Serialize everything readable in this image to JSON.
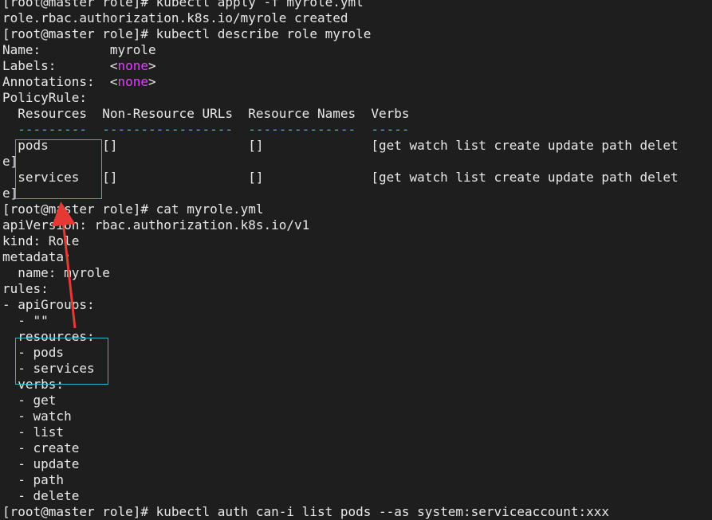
{
  "terminal": {
    "lines": [
      {
        "t": "[root@master role]# kubectl apply -f myrole.yml"
      },
      {
        "t": "role.rbac.authorization.k8s.io/myrole created"
      },
      {
        "t": "[root@master role]# kubectl describe role myrole"
      },
      {
        "t": "Name:         myrole"
      },
      {
        "t": "Labels:       <",
        "none": "none",
        "after": ">"
      },
      {
        "t": "Annotations:  <",
        "none": "none",
        "after": ">"
      },
      {
        "t": "PolicyRule:"
      },
      {
        "t": "  Resources  Non-Resource URLs  Resource Names  Verbs"
      },
      {
        "dash": "  ---------  -----------------  --------------  -----"
      },
      {
        "t": "  pods       []                 []              [get watch list create update path delet"
      },
      {
        "t": "e]"
      },
      {
        "t": "  services   []                 []              [get watch list create update path delet"
      },
      {
        "t": "e]"
      },
      {
        "t": "[root@master role]# cat myrole.yml"
      },
      {
        "t": "apiVersion: rbac.authorization.k8s.io/v1"
      },
      {
        "t": "kind: Role"
      },
      {
        "t": "metadata:"
      },
      {
        "t": "  name: myrole"
      },
      {
        "t": "rules:"
      },
      {
        "t": "- apiGroups:"
      },
      {
        "t": "  - \"\""
      },
      {
        "t": "  resources:"
      },
      {
        "t": "  - pods"
      },
      {
        "t": "  - services"
      },
      {
        "t": "  verbs:"
      },
      {
        "t": "  - get"
      },
      {
        "t": "  - watch"
      },
      {
        "t": "  - list"
      },
      {
        "t": "  - create"
      },
      {
        "t": "  - update"
      },
      {
        "t": "  - path"
      },
      {
        "t": "  - delete"
      },
      {
        "t": "[root@master role]# kubectl auth can-i list pods --as system:serviceaccount:xxx"
      }
    ]
  },
  "colors": {
    "background": "#1e1e1e",
    "text": "#e8e8e8",
    "none_value": "#e040ff",
    "dashes": "#5aa0ff",
    "highlight_box": "#2bb7c3",
    "arrow": "#e53935"
  }
}
